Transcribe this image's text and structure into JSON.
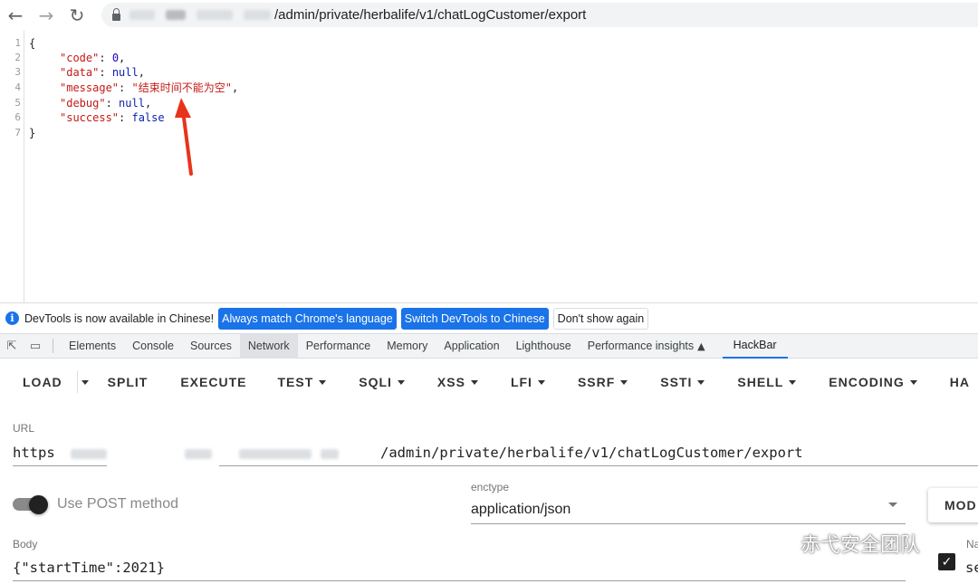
{
  "browser": {
    "back_icon": "arrow-left-icon",
    "forward_icon": "arrow-right-icon",
    "reload_icon": "reload-icon",
    "url_visible": "/admin/private/herbalife/v1/chatLogCustomer/export"
  },
  "response_json": {
    "line_numbers": [
      "1",
      "2",
      "3",
      "4",
      "5",
      "6",
      "7"
    ],
    "open_brace": "{",
    "close_brace": "}",
    "fields": [
      {
        "key": "\"code\"",
        "value": "0",
        "type": "num"
      },
      {
        "key": "\"data\"",
        "value": "null",
        "type": "null"
      },
      {
        "key": "\"message\"",
        "value": "\"结束时间不能为空\"",
        "type": "str"
      },
      {
        "key": "\"debug\"",
        "value": "null",
        "type": "null"
      },
      {
        "key": "\"success\"",
        "value": "false",
        "type": "null"
      }
    ]
  },
  "devtools": {
    "infobar": {
      "text": "DevTools is now available in Chinese!",
      "btn_match": "Always match Chrome's language",
      "btn_switch": "Switch DevTools to Chinese",
      "btn_dismiss": "Don't show again"
    },
    "tabs": [
      "Elements",
      "Console",
      "Sources",
      "Network",
      "Performance",
      "Memory",
      "Application",
      "Lighthouse",
      "Performance insights",
      "HackBar"
    ],
    "active_tab": "Network",
    "selected_tab": "HackBar"
  },
  "hackbar": {
    "toolbar": {
      "load": "LOAD",
      "split": "SPLIT",
      "execute": "EXECUTE",
      "test": "TEST",
      "sqli": "SQLI",
      "xss": "XSS",
      "lfi": "LFI",
      "ssrf": "SSRF",
      "ssti": "SSTI",
      "shell": "SHELL",
      "encoding": "ENCODING",
      "more": "HA"
    },
    "url_label": "URL",
    "url_prefix": "https",
    "url_path": "/admin/private/herbalife/v1/chatLogCustomer/export",
    "post_label": "Use POST method",
    "post_enabled": true,
    "enctype_label": "enctype",
    "enctype_value": "application/json",
    "modify_button": "MOD",
    "body_label": "Body",
    "body_value": "{\"startTime\":2021}",
    "side_label": "Na",
    "side_value": "se",
    "checkbox_checked": true
  },
  "watermark": {
    "text": "赤弋安全团队"
  },
  "colors": {
    "accent": "#1a73e8",
    "json_key": "#c41a16",
    "json_num": "#1c00cf",
    "annotation_arrow": "#e8331c"
  }
}
